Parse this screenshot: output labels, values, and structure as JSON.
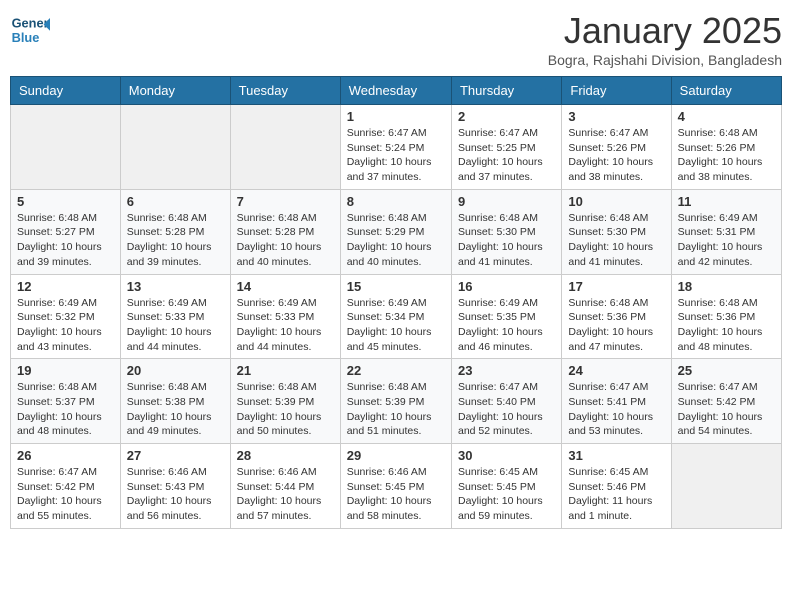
{
  "header": {
    "logo_line1": "General",
    "logo_line2": "Blue",
    "month_title": "January 2025",
    "subtitle": "Bogra, Rajshahi Division, Bangladesh"
  },
  "days_of_week": [
    "Sunday",
    "Monday",
    "Tuesday",
    "Wednesday",
    "Thursday",
    "Friday",
    "Saturday"
  ],
  "weeks": [
    [
      {
        "day": "",
        "info": ""
      },
      {
        "day": "",
        "info": ""
      },
      {
        "day": "",
        "info": ""
      },
      {
        "day": "1",
        "info": "Sunrise: 6:47 AM\nSunset: 5:24 PM\nDaylight: 10 hours\nand 37 minutes."
      },
      {
        "day": "2",
        "info": "Sunrise: 6:47 AM\nSunset: 5:25 PM\nDaylight: 10 hours\nand 37 minutes."
      },
      {
        "day": "3",
        "info": "Sunrise: 6:47 AM\nSunset: 5:26 PM\nDaylight: 10 hours\nand 38 minutes."
      },
      {
        "day": "4",
        "info": "Sunrise: 6:48 AM\nSunset: 5:26 PM\nDaylight: 10 hours\nand 38 minutes."
      }
    ],
    [
      {
        "day": "5",
        "info": "Sunrise: 6:48 AM\nSunset: 5:27 PM\nDaylight: 10 hours\nand 39 minutes."
      },
      {
        "day": "6",
        "info": "Sunrise: 6:48 AM\nSunset: 5:28 PM\nDaylight: 10 hours\nand 39 minutes."
      },
      {
        "day": "7",
        "info": "Sunrise: 6:48 AM\nSunset: 5:28 PM\nDaylight: 10 hours\nand 40 minutes."
      },
      {
        "day": "8",
        "info": "Sunrise: 6:48 AM\nSunset: 5:29 PM\nDaylight: 10 hours\nand 40 minutes."
      },
      {
        "day": "9",
        "info": "Sunrise: 6:48 AM\nSunset: 5:30 PM\nDaylight: 10 hours\nand 41 minutes."
      },
      {
        "day": "10",
        "info": "Sunrise: 6:48 AM\nSunset: 5:30 PM\nDaylight: 10 hours\nand 41 minutes."
      },
      {
        "day": "11",
        "info": "Sunrise: 6:49 AM\nSunset: 5:31 PM\nDaylight: 10 hours\nand 42 minutes."
      }
    ],
    [
      {
        "day": "12",
        "info": "Sunrise: 6:49 AM\nSunset: 5:32 PM\nDaylight: 10 hours\nand 43 minutes."
      },
      {
        "day": "13",
        "info": "Sunrise: 6:49 AM\nSunset: 5:33 PM\nDaylight: 10 hours\nand 44 minutes."
      },
      {
        "day": "14",
        "info": "Sunrise: 6:49 AM\nSunset: 5:33 PM\nDaylight: 10 hours\nand 44 minutes."
      },
      {
        "day": "15",
        "info": "Sunrise: 6:49 AM\nSunset: 5:34 PM\nDaylight: 10 hours\nand 45 minutes."
      },
      {
        "day": "16",
        "info": "Sunrise: 6:49 AM\nSunset: 5:35 PM\nDaylight: 10 hours\nand 46 minutes."
      },
      {
        "day": "17",
        "info": "Sunrise: 6:48 AM\nSunset: 5:36 PM\nDaylight: 10 hours\nand 47 minutes."
      },
      {
        "day": "18",
        "info": "Sunrise: 6:48 AM\nSunset: 5:36 PM\nDaylight: 10 hours\nand 48 minutes."
      }
    ],
    [
      {
        "day": "19",
        "info": "Sunrise: 6:48 AM\nSunset: 5:37 PM\nDaylight: 10 hours\nand 48 minutes."
      },
      {
        "day": "20",
        "info": "Sunrise: 6:48 AM\nSunset: 5:38 PM\nDaylight: 10 hours\nand 49 minutes."
      },
      {
        "day": "21",
        "info": "Sunrise: 6:48 AM\nSunset: 5:39 PM\nDaylight: 10 hours\nand 50 minutes."
      },
      {
        "day": "22",
        "info": "Sunrise: 6:48 AM\nSunset: 5:39 PM\nDaylight: 10 hours\nand 51 minutes."
      },
      {
        "day": "23",
        "info": "Sunrise: 6:47 AM\nSunset: 5:40 PM\nDaylight: 10 hours\nand 52 minutes."
      },
      {
        "day": "24",
        "info": "Sunrise: 6:47 AM\nSunset: 5:41 PM\nDaylight: 10 hours\nand 53 minutes."
      },
      {
        "day": "25",
        "info": "Sunrise: 6:47 AM\nSunset: 5:42 PM\nDaylight: 10 hours\nand 54 minutes."
      }
    ],
    [
      {
        "day": "26",
        "info": "Sunrise: 6:47 AM\nSunset: 5:42 PM\nDaylight: 10 hours\nand 55 minutes."
      },
      {
        "day": "27",
        "info": "Sunrise: 6:46 AM\nSunset: 5:43 PM\nDaylight: 10 hours\nand 56 minutes."
      },
      {
        "day": "28",
        "info": "Sunrise: 6:46 AM\nSunset: 5:44 PM\nDaylight: 10 hours\nand 57 minutes."
      },
      {
        "day": "29",
        "info": "Sunrise: 6:46 AM\nSunset: 5:45 PM\nDaylight: 10 hours\nand 58 minutes."
      },
      {
        "day": "30",
        "info": "Sunrise: 6:45 AM\nSunset: 5:45 PM\nDaylight: 10 hours\nand 59 minutes."
      },
      {
        "day": "31",
        "info": "Sunrise: 6:45 AM\nSunset: 5:46 PM\nDaylight: 11 hours\nand 1 minute."
      },
      {
        "day": "",
        "info": ""
      }
    ]
  ]
}
